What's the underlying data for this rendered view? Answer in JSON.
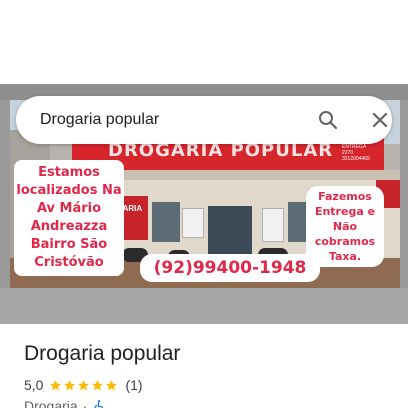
{
  "search": {
    "query": "Drogaria popular"
  },
  "photo": {
    "store_sign": "DROGARIA POPULAR",
    "sign_small": "ENTREGA 2270 3212004465",
    "left_sign": "TU ARIA DE",
    "promo_left": "Estamos localizados Na Av Mário Andreazza Bairro São Cristóvão",
    "promo_right": "Fazemos Entrega e Não cobramos Taxa.",
    "promo_phone": "(92)99400-1948"
  },
  "place": {
    "title": "Drogaria popular",
    "rating": "5,0",
    "star_count": 5,
    "review_count": "(1)",
    "category": "Drogaria",
    "separator": "·"
  },
  "icons": {
    "search": "search-icon",
    "close": "close-icon",
    "star": "star-icon",
    "accessibility": "wheelchair-icon"
  },
  "colors": {
    "star": "#fbbc04",
    "promo_text": "#e0294a",
    "sign_red": "#d7252c",
    "accessibility_blue": "#1a73e8"
  }
}
